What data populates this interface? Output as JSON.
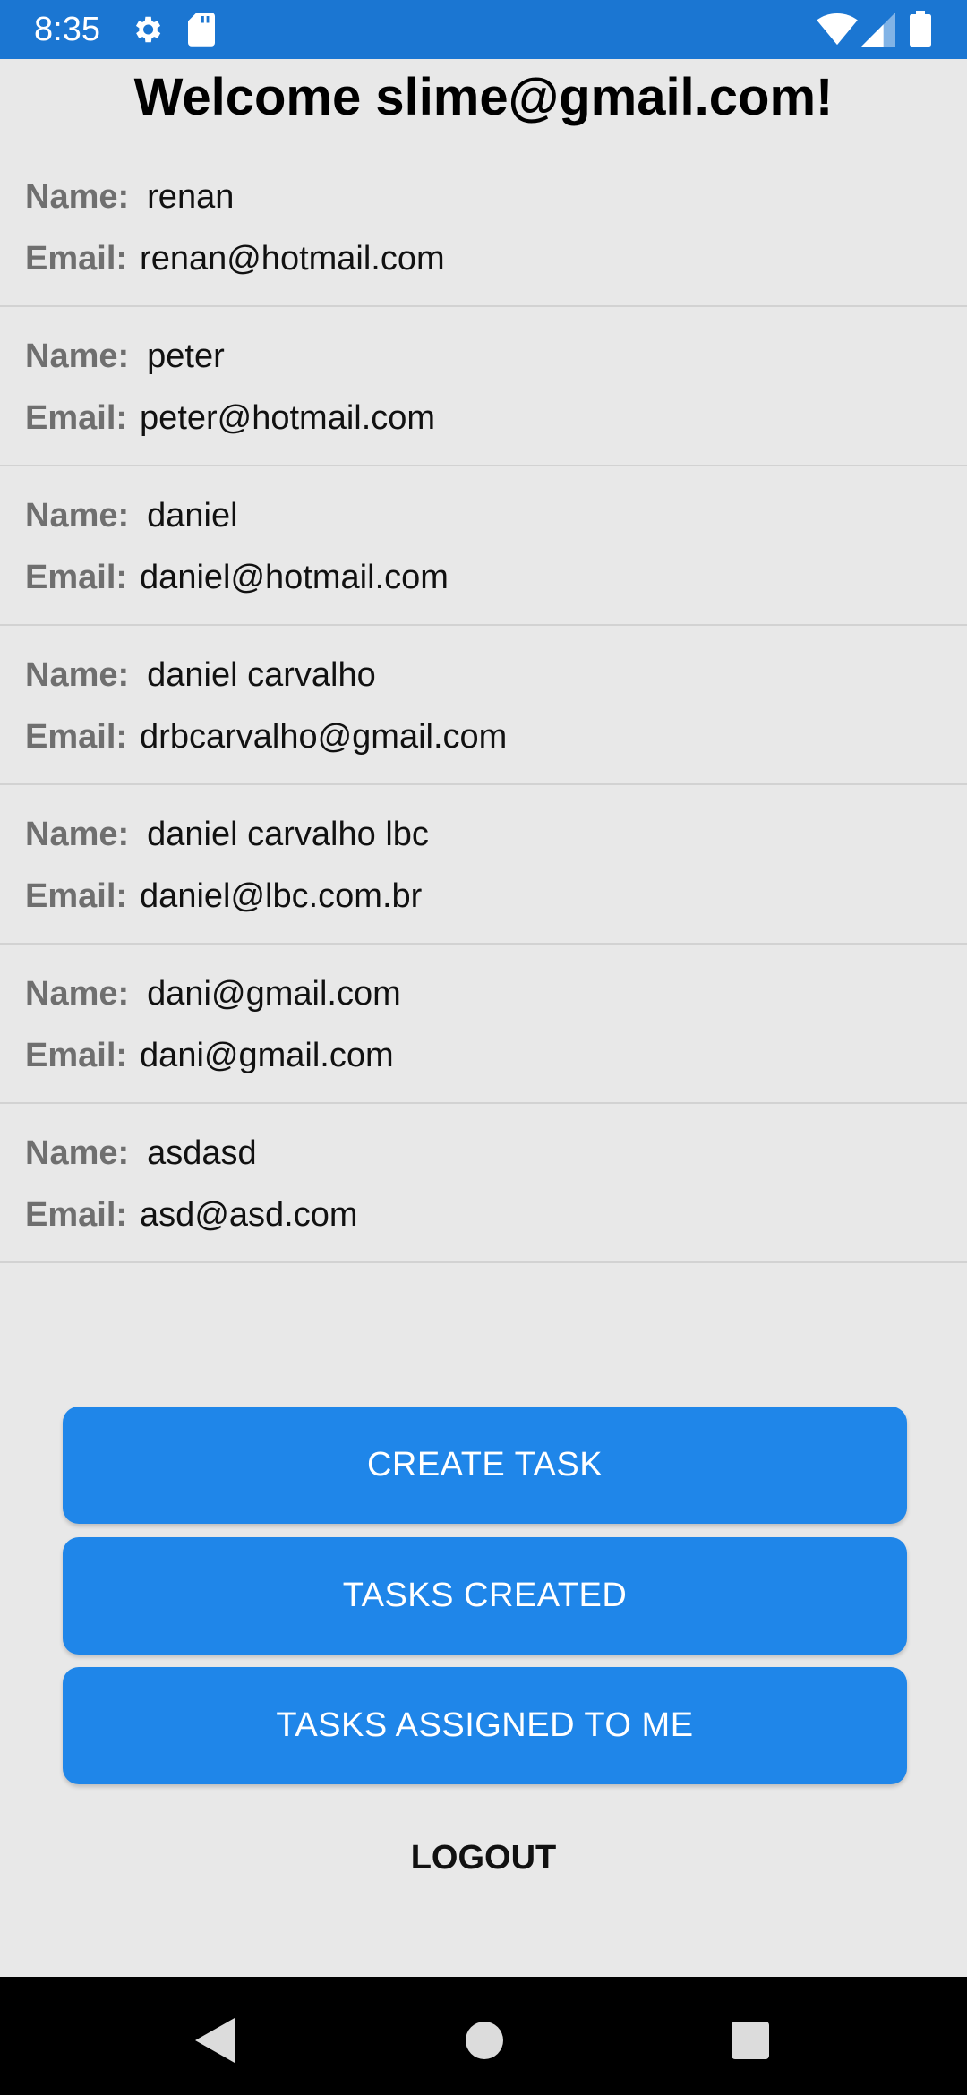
{
  "status_bar": {
    "time": "8:35",
    "icons": [
      "gear-icon",
      "sd-card-icon",
      "wifi-icon",
      "cell-signal-icon",
      "battery-icon"
    ],
    "background_color": "#1b76d2"
  },
  "welcome": {
    "title": "Welcome slime@gmail.com!"
  },
  "labels": {
    "name": "Name:",
    "email": "Email:"
  },
  "users": [
    {
      "name": "renan",
      "email": "renan@hotmail.com"
    },
    {
      "name": "peter",
      "email": "peter@hotmail.com"
    },
    {
      "name": "daniel",
      "email": "daniel@hotmail.com"
    },
    {
      "name": "daniel carvalho",
      "email": "drbcarvalho@gmail.com"
    },
    {
      "name": "daniel carvalho lbc",
      "email": "daniel@lbc.com.br"
    },
    {
      "name": "dani@gmail.com",
      "email": "dani@gmail.com"
    },
    {
      "name": "asdasd",
      "email": "asd@asd.com"
    }
  ],
  "actions": {
    "create_task": "CREATE TASK",
    "tasks_created": "TASKS CREATED",
    "tasks_assigned": "TASKS ASSIGNED TO ME",
    "logout": "LOGOUT"
  },
  "colors": {
    "accent": "#1f86e9",
    "background": "#e8e8e8",
    "label": "#6f6f6f"
  },
  "nav_bar": {
    "icons": [
      "back-icon",
      "home-icon",
      "recents-icon"
    ]
  }
}
